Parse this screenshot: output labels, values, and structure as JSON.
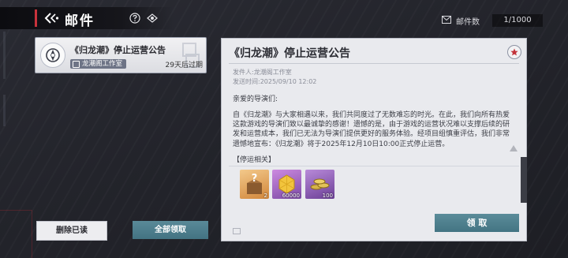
{
  "header": {
    "title": "邮件"
  },
  "mail_count": {
    "label": "邮件数",
    "value": "1/1000"
  },
  "mail_list": [
    {
      "subject": "《归龙潮》停止运营公告",
      "sender": "龙潮阁工作室",
      "expire": "29天后过期"
    }
  ],
  "actions": {
    "delete_read": "删除已读",
    "claim_all": "全部领取"
  },
  "detail": {
    "title": "《归龙潮》停止运营公告",
    "sender": "发件人:龙潮阁工作室",
    "send_time": "发送时间:2025/09/10 12:02",
    "greeting": "亲爱的导演们:",
    "body": "自《归龙潮》与大家相遇以来，我们共同度过了无数难忘的时光。在此，我们向所有热爱这款游戏的导演们致以最诚挚的感谢！遗憾的是，由于游戏的运营状况难以支撑后续的研发和运营成本，我们已无法为导演们提供更好的服务体验。经项目组慎重评估，我们非常遗憾地宣布：《归龙潮》将于2025年12月10日10:00正式停止运营。",
    "tag": "【停运相关】",
    "rewards": [
      {
        "icon": "mystery-box-icon",
        "count": "2"
      },
      {
        "icon": "gold-crystal-icon",
        "count": "60000"
      },
      {
        "icon": "coin-pile-icon",
        "count": "100"
      }
    ],
    "claim": "领 取"
  }
}
